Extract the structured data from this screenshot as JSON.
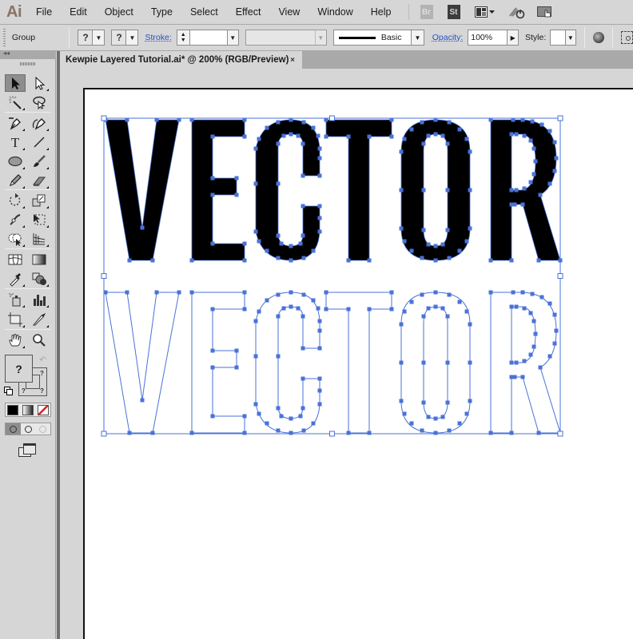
{
  "app": {
    "logo": "Ai"
  },
  "menu": [
    "File",
    "Edit",
    "Object",
    "Type",
    "Select",
    "Effect",
    "View",
    "Window",
    "Help"
  ],
  "menubar_icons": {
    "bridge": "Br",
    "stock": "St",
    "workspace": "workspace-layout-icon",
    "sync": "sync-icon",
    "arrange": "arrange-documents-icon"
  },
  "controlbar": {
    "selection_type": "Group",
    "fill_value": "?",
    "stroke_swatch_value": "?",
    "stroke_label": "Stroke:",
    "stroke_weight": "",
    "variable_width": "",
    "brush_name": "Basic",
    "opacity_label": "Opacity:",
    "opacity_value": "100%",
    "style_label": "Style:"
  },
  "document": {
    "tab_title": "Kewpie Layered Tutorial.ai* @ 200% (RGB/Preview)",
    "close_glyph": "×",
    "zoom": "200%",
    "color_mode": "RGB/Preview"
  },
  "tools": {
    "fill_value": "?",
    "stroke_value": "?",
    "stroke_inner_value": "?",
    "swap_glyph": "↶",
    "items": [
      "selection",
      "direct-selection",
      "magic-wand",
      "lasso",
      "pen",
      "curvature",
      "type",
      "line-segment",
      "ellipse",
      "paintbrush",
      "pencil",
      "eraser",
      "rotate",
      "scale",
      "width",
      "free-transform",
      "shape-builder",
      "perspective-grid",
      "mesh",
      "gradient",
      "eyedropper",
      "blend",
      "symbol-sprayer",
      "column-graph",
      "artboard",
      "slice",
      "hand",
      "zoom"
    ],
    "active": "selection"
  },
  "artwork": {
    "text": "VECTOR",
    "filled_layer": {
      "fill": "#000000",
      "selection_color": "#4a72d8"
    },
    "outline_layer": {
      "fill": "none",
      "stroke": "#4a72d8"
    }
  }
}
